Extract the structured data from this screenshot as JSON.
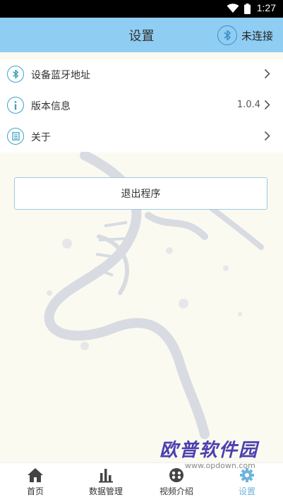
{
  "status_bar": {
    "time": "1:27"
  },
  "header": {
    "title": "设置",
    "bluetooth_status": "未连接"
  },
  "menu": {
    "items": [
      {
        "label": "设备蓝牙地址",
        "value": ""
      },
      {
        "label": "版本信息",
        "value": "1.0.4"
      },
      {
        "label": "关于",
        "value": ""
      }
    ]
  },
  "logout": {
    "label": "退出程序"
  },
  "tabbar": {
    "tabs": [
      {
        "label": "首页",
        "icon": "home-icon"
      },
      {
        "label": "数据管理",
        "icon": "bar-chart-icon"
      },
      {
        "label": "视频介绍",
        "icon": "video-icon"
      },
      {
        "label": "设置",
        "icon": "gear-icon",
        "active": true
      }
    ]
  },
  "watermark": {
    "brand": "欧普软件园",
    "url": "www.opdown.com"
  },
  "colors": {
    "header": "#8fcdf3",
    "accent": "#3fa3c2",
    "active_tab": "#6fb4de"
  }
}
